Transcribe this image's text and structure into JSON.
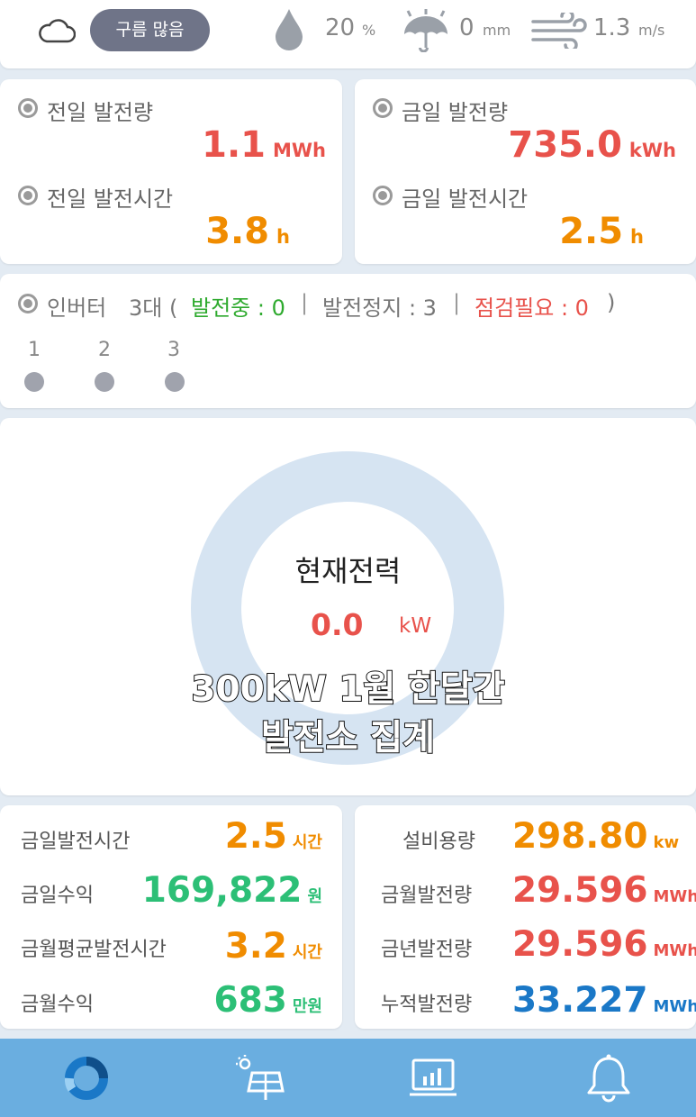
{
  "weather": {
    "sky": "구름 많음",
    "humidity_value": "20",
    "humidity_unit": "%",
    "rain_value": "0",
    "rain_unit": "mm",
    "wind_value": "1.3",
    "wind_unit": "m/s"
  },
  "prev_day": {
    "gen_label": "전일 발전량",
    "gen_value": "1.1",
    "gen_unit": "MWh",
    "time_label": "전일 발전시간",
    "time_value": "3.8",
    "time_unit": "h"
  },
  "today": {
    "gen_label": "금일 발전량",
    "gen_value": "735.0",
    "gen_unit": "kWh",
    "time_label": "금일 발전시간",
    "time_value": "2.5",
    "time_unit": "h"
  },
  "inverter": {
    "label": "인버터",
    "count": "3대 (",
    "running": "발전중 : 0",
    "sep1": "|",
    "stopped": "발전정지 : 3",
    "sep2": "|",
    "check": "점검필요 : 0",
    "close": ")",
    "units": [
      {
        "num": "1",
        "status": "stopped"
      },
      {
        "num": "2",
        "status": "stopped"
      },
      {
        "num": "3",
        "status": "stopped"
      }
    ]
  },
  "current_power": {
    "title": "현재전력",
    "value": "0.0",
    "unit": "kW"
  },
  "overlay": {
    "line1": "300kW 1월 한달간",
    "line2": "발전소 집계"
  },
  "summary_left": [
    {
      "label": "금일발전시간",
      "value": "2.5",
      "unit": "시간"
    },
    {
      "label": "금일수익",
      "value": "169,822",
      "unit": "원"
    },
    {
      "label": "금월평균발전시간",
      "value": "3.2",
      "unit": "시간"
    },
    {
      "label": "금월수익",
      "value": "683",
      "unit": "만원"
    }
  ],
  "summary_right": [
    {
      "label": "설비용량",
      "value": "298.80",
      "unit": "kw"
    },
    {
      "label": "금월발전량",
      "value": "29.596",
      "unit": "MWh"
    },
    {
      "label": "금년발전량",
      "value": "29.596",
      "unit": "MWh"
    },
    {
      "label": "누적발전량",
      "value": "33.227",
      "unit": "MWh"
    }
  ],
  "nav": {
    "items": [
      "dashboard-icon",
      "solar-panel-icon",
      "chart-icon",
      "bell-icon"
    ]
  },
  "colors": {
    "red": "#e8524b",
    "orange": "#f08c00",
    "green": "#2cbf76",
    "blue": "#1a78c7",
    "nav": "#6aaee0"
  }
}
